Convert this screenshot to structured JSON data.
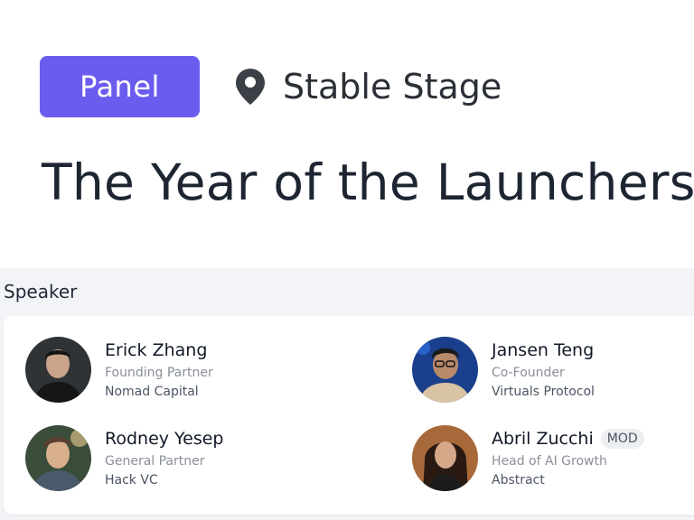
{
  "header": {
    "badge_label": "Panel",
    "venue": "Stable Stage",
    "title": "The Year of the Launchers"
  },
  "speakers_section": {
    "label": "Speaker",
    "speakers": [
      {
        "name": "Erick Zhang",
        "role": "Founding Partner",
        "org": "Nomad Capital",
        "badge": ""
      },
      {
        "name": "Jansen Teng",
        "role": "Co-Founder",
        "org": "Virtuals Protocol",
        "badge": ""
      },
      {
        "name": "Rodney Yesep",
        "role": "General Partner",
        "org": "Hack VC",
        "badge": ""
      },
      {
        "name": "Abril Zucchi",
        "role": "Head of AI Growth",
        "org": "Abstract",
        "badge": "MOD"
      }
    ]
  },
  "colors": {
    "accent": "#6b5cf0",
    "section_bg": "#f3f4f7"
  }
}
